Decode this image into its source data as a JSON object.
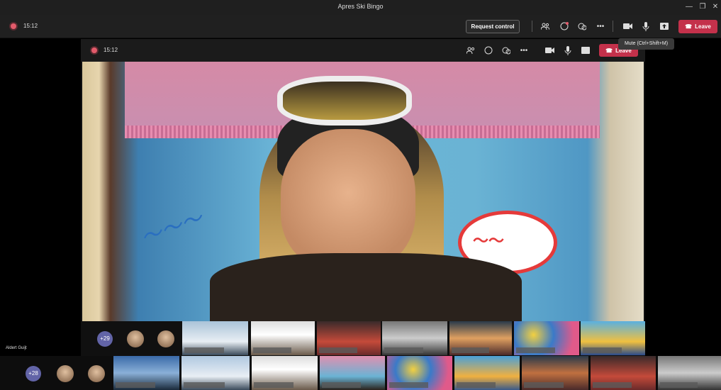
{
  "window": {
    "title": "Apres Ski Bingo",
    "minimize": "—",
    "restore": "❐",
    "close": "✕"
  },
  "toolbar": {
    "time": "15:12",
    "request_control": "Request control",
    "leave": "Leave",
    "tooltip": "Mute (Ctrl+Shift+M)",
    "icons": [
      "people-icon",
      "chat-icon",
      "reactions-icon",
      "more-icon",
      "camera-icon",
      "mic-icon",
      "share-icon"
    ]
  },
  "shared": {
    "time": "15:12",
    "leave": "Leave"
  },
  "participants": {
    "row1_overflow": "+29",
    "row2_overflow": "+28",
    "local_name": "Aldert Guijt"
  },
  "colors": {
    "accent": "#6264a7",
    "leave": "#c4314b",
    "recording": "#e35b6b"
  }
}
